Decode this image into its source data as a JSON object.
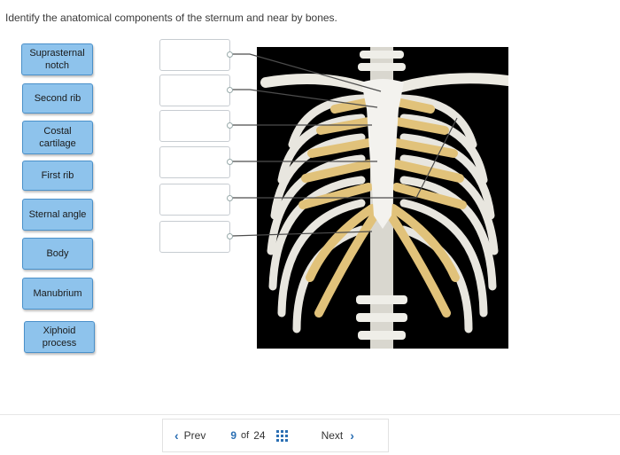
{
  "question": "Identify the anatomical components of the sternum and near by bones.",
  "labels": [
    {
      "text": "Suprasternal\nnotch"
    },
    {
      "text": "Second rib"
    },
    {
      "text": "Costal\ncartilage"
    },
    {
      "text": "First rib"
    },
    {
      "text": "Sternal angle"
    },
    {
      "text": "Body"
    },
    {
      "text": "Manubrium"
    },
    {
      "text": "Xiphoid\nprocess"
    }
  ],
  "drop_zone_count": 6,
  "figure": {
    "icon": "rib-cage-image"
  },
  "nav": {
    "prev_label": "Prev",
    "next_label": "Next",
    "current_page": "9",
    "of_label": "of",
    "total_pages": "24",
    "grid_icon": "grid-icon"
  },
  "colors": {
    "chip_fill": "#8ec3ec",
    "chip_border": "#4a90c9",
    "accent": "#2b6fb3"
  }
}
